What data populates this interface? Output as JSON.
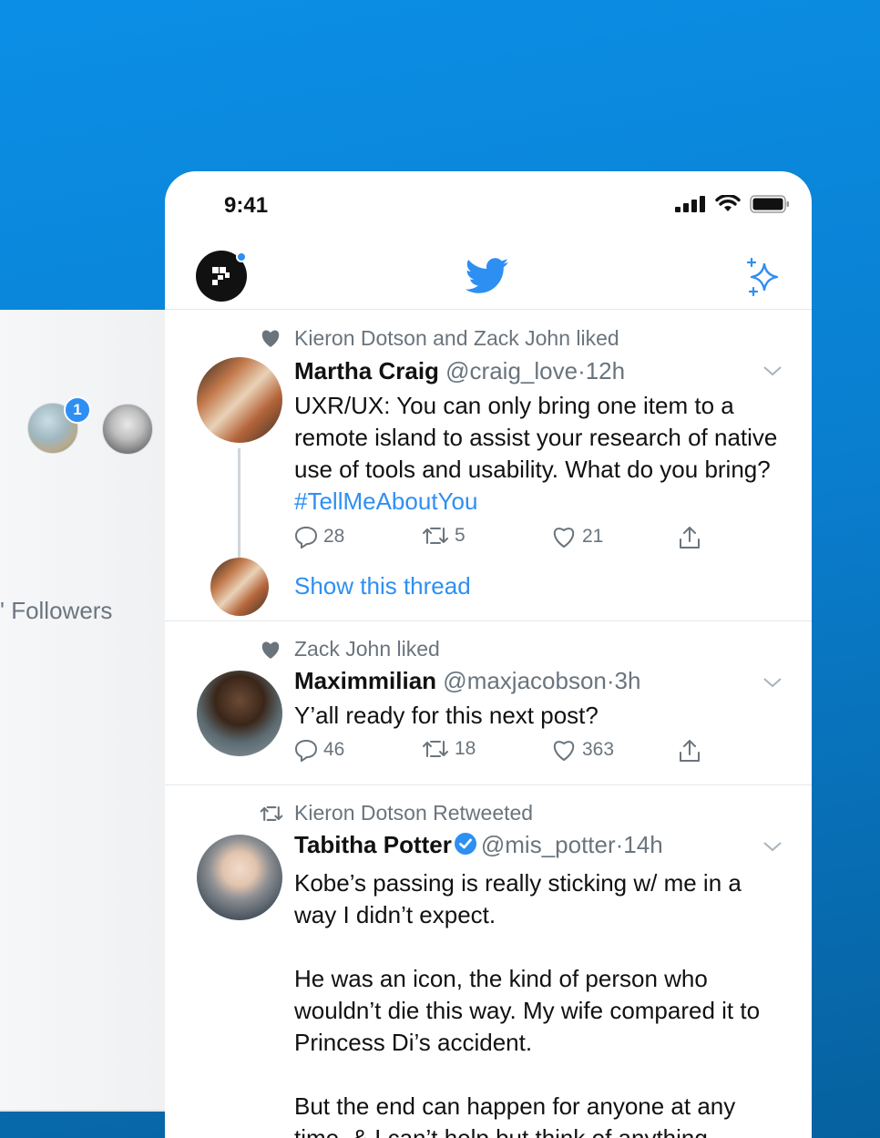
{
  "background": {
    "badge_count": "1",
    "followers_text": "' Followers"
  },
  "status_bar": {
    "time": "9:41"
  },
  "header": {
    "logo_icon": "profile-logo-icon",
    "center_icon": "twitter-bird-icon",
    "right_icon": "sparkle-icon"
  },
  "tweets": [
    {
      "context_icon": "heart-icon",
      "context": "Kieron Dotson and Zack John liked",
      "name": "Martha Craig",
      "handle": "@craig_love",
      "time": "·12h",
      "text": "UXR/UX: You can only bring one item to a remote island to assist your research of native use of tools and usability. What do you bring?",
      "hashtag": "#TellMeAboutYou",
      "replies": "28",
      "retweets": "5",
      "likes": "21",
      "show_thread": "Show this thread"
    },
    {
      "context_icon": "heart-icon",
      "context": "Zack John liked",
      "name": "Maximmilian",
      "handle": "@maxjacobson",
      "time": "·3h",
      "text": "Y’all ready for this next post?",
      "replies": "46",
      "retweets": "18",
      "likes": "363"
    },
    {
      "context_icon": "retweet-icon",
      "context": "Kieron Dotson Retweeted",
      "name": "Tabitha Potter",
      "handle": "@mis_potter",
      "time": "·14h",
      "text_p1": "Kobe’s passing is really sticking w/ me in a way I didn’t expect.",
      "text_p2": "He was an icon, the kind of person who wouldn’t die this way. My wife compared it to Princess Di’s accident.",
      "text_p3": "But the end can happen for anyone at any time, & I can’t help but think of anything"
    }
  ],
  "colors": {
    "accent": "#2e8ff2",
    "secondary_text": "#6a747d",
    "background_gradient_top": "#0b8fe6",
    "background_gradient_bottom": "#06619f"
  }
}
